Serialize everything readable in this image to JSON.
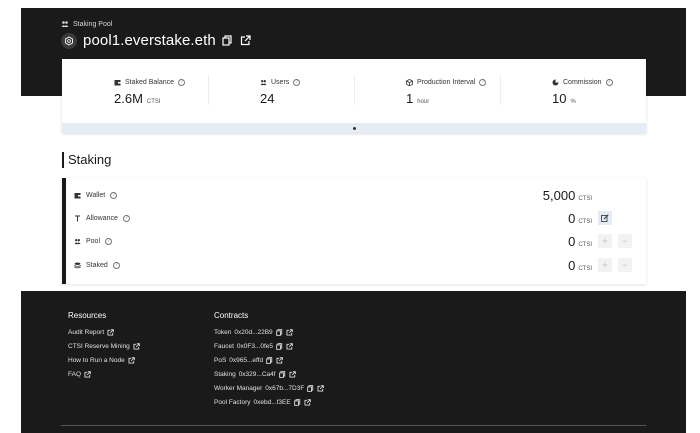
{
  "header": {
    "breadcrumb": "Staking Pool",
    "pool_name": "pool1.everstake.eth"
  },
  "stats": [
    {
      "label": "Staked Balance",
      "value": "2.6M",
      "unit": "CTSI",
      "icon": "wallet-icon"
    },
    {
      "label": "Users",
      "value": "24",
      "unit": "",
      "icon": "users-icon"
    },
    {
      "label": "Production Interval",
      "value": "1",
      "unit": "hour",
      "icon": "cube-icon"
    },
    {
      "label": "Commission",
      "value": "10",
      "unit": "%",
      "icon": "pie-icon"
    }
  ],
  "staking": {
    "title": "Staking",
    "rows": [
      {
        "label": "Wallet",
        "value": "5,000",
        "unit": "CTSI",
        "icon": "wallet-icon"
      },
      {
        "label": "Allowance",
        "value": "0",
        "unit": "CTSI",
        "icon": "allowance-icon"
      },
      {
        "label": "Pool",
        "value": "0",
        "unit": "CTSI",
        "icon": "users-icon"
      },
      {
        "label": "Staked",
        "value": "0",
        "unit": "CTSI",
        "icon": "staked-icon"
      }
    ],
    "plus": "+",
    "minus": "−"
  },
  "footer": {
    "resources_title": "Resources",
    "resources": [
      "Audit Report",
      "CTSI Reserve Mining",
      "How to Run a Node",
      "FAQ"
    ],
    "contracts_title": "Contracts",
    "contracts": [
      {
        "name": "Token",
        "address": "0x20d...22B9"
      },
      {
        "name": "Faucet",
        "address": "0x0F3...0fe5"
      },
      {
        "name": "PoS",
        "address": "0x965...effd"
      },
      {
        "name": "Staking",
        "address": "0x329...Ca4f"
      },
      {
        "name": "Worker Manager",
        "address": "0x67b...7D3F"
      },
      {
        "name": "Pool Factory",
        "address": "0xebd...f3EE"
      }
    ]
  },
  "colors": {
    "dark": "#1a1a1a",
    "toggle_bar": "#e6ecf5"
  }
}
